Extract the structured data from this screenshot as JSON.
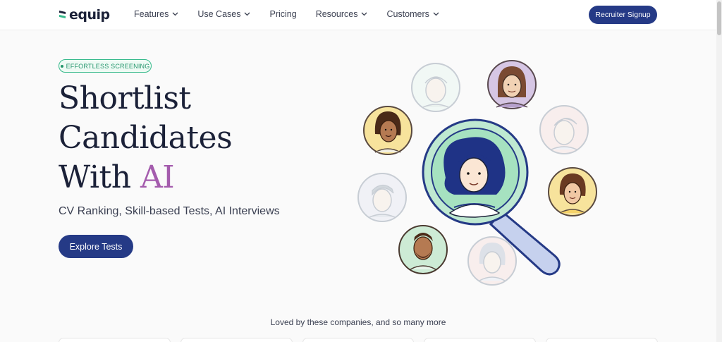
{
  "nav": {
    "brand": "equip",
    "items": [
      {
        "label": "Features",
        "has_dropdown": true
      },
      {
        "label": "Use Cases",
        "has_dropdown": true
      },
      {
        "label": "Pricing",
        "has_dropdown": false
      },
      {
        "label": "Resources",
        "has_dropdown": true
      },
      {
        "label": "Customers",
        "has_dropdown": true
      }
    ],
    "cta": "Recruiter Signup"
  },
  "hero": {
    "badge": "EFFORTLESS SCREENING",
    "title_line1": "Shortlist",
    "title_line2": "Candidates",
    "title_line3_plain": "With ",
    "title_line3_accent": "AI",
    "subtitle": "CV Ranking, Skill-based Tests, AI Interviews",
    "button": "Explore Tests"
  },
  "companies": {
    "heading": "Loved by these companies, and so many more"
  },
  "colors": {
    "brand": "#253a86",
    "accent": "#a45cad",
    "badge_green": "#23956b"
  },
  "icons": {
    "logo": "equip-logo-mark",
    "dropdown": "chevron-down-icon",
    "illustration": "magnifying-glass-candidates"
  }
}
